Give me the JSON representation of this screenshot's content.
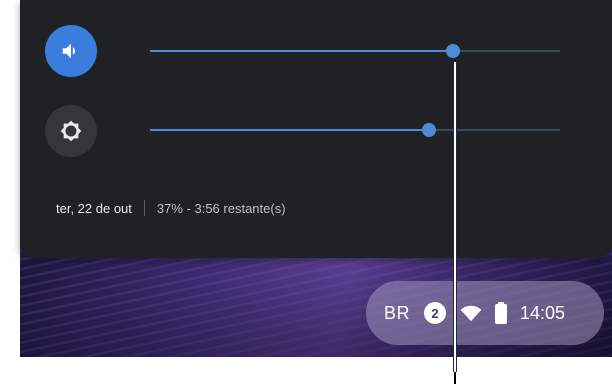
{
  "quick_settings": {
    "volume": {
      "icon": "speaker-icon",
      "level": 0.74
    },
    "brightness": {
      "icon": "brightness-icon",
      "level": 0.68
    },
    "date": "ter, 22 de out",
    "battery_status": "37% - 3:56 restante(s)"
  },
  "tray": {
    "ime": "BR",
    "notification_count": "2",
    "wifi_icon": "wifi-icon",
    "battery_icon": "battery-icon",
    "time": "14:05"
  },
  "colors": {
    "panel": "#202124",
    "accent": "#4f8ad9",
    "volume_button": "#3b7ddd"
  }
}
